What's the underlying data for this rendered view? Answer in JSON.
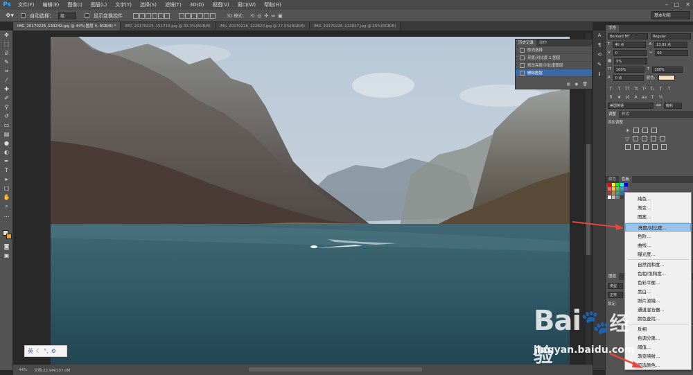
{
  "app": {
    "logo": "Ps"
  },
  "menubar": {
    "items": [
      "文件(F)",
      "编辑(E)",
      "图像(I)",
      "图层(L)",
      "文字(Y)",
      "选择(S)",
      "滤镜(T)",
      "3D(D)",
      "视图(V)",
      "窗口(W)",
      "帮助(H)"
    ],
    "window_controls": [
      "–",
      "□",
      "✕"
    ]
  },
  "options": {
    "auto_select_label": "自动选择：",
    "auto_select_value": "组",
    "show_transform_label": "显示变换控件",
    "mode_3d_label": "3D 模式：",
    "workspace": "基本功能"
  },
  "tabs": [
    {
      "label": "IMG_20170226_133242.jpg @ 44%(图层 4, RGB/8) *",
      "active": true
    },
    {
      "label": "IMG_20170225_151715.jpg @ 33.3%(RGB/8)",
      "active": false
    },
    {
      "label": "IMG_20170226_122820.jpg @ 27.5%(RGB/8)",
      "active": false
    },
    {
      "label": "IMG_20170226_122827.jpg @ 25%(RGB/8)",
      "active": false
    }
  ],
  "history": {
    "tabs": [
      "历史记录",
      "动作"
    ],
    "items": [
      {
        "label": "取消选择",
        "selected": false
      },
      {
        "label": "亮度/对比度 1 图层",
        "selected": false
      },
      {
        "label": "修改亮度/对比度图层",
        "selected": false
      },
      {
        "label": "删除图层",
        "selected": true
      }
    ]
  },
  "status": {
    "zoom": "44%",
    "doc_size": "文档:22.9M/107.0M"
  },
  "ime": {
    "label": "英"
  },
  "character": {
    "tab": "字符",
    "font_family": "Bernard MT ...",
    "font_style": "Regular",
    "size": "40 点",
    "leading": "13.93 点",
    "kerning": "0",
    "tracking": "60",
    "vscale": "100%",
    "hscale": "100%",
    "baseline": "0 点",
    "color_label": "颜色:",
    "tracking_pct": "0%",
    "language": "美国英语",
    "aa": "锐利"
  },
  "adjust": {
    "tabs": [
      "调整",
      "样式"
    ],
    "title": "添加调整"
  },
  "color_panel": {
    "tabs": [
      "颜色",
      "色板"
    ]
  },
  "layers": {
    "tabs": [
      "图层"
    ],
    "kind": "类型",
    "blend": "正常",
    "lock_label": "锁定:"
  },
  "context_menu": {
    "items": [
      "纯色...",
      "渐变...",
      "图案...",
      "亮度/对比度...",
      "色阶...",
      "曲线...",
      "曝光度...",
      "自然饱和度...",
      "色相/饱和度...",
      "色彩平衡...",
      "黑白...",
      "照片滤镜...",
      "通道混合器...",
      "颜色查找...",
      "反相",
      "色调分离...",
      "阈值...",
      "渐变映射...",
      "可选颜色..."
    ],
    "highlighted_index": 3
  },
  "watermark": {
    "brand_a": "Bai",
    "brand_b": "经验",
    "url": "jingyan.baidu.com"
  },
  "colors": {
    "accent_blue": "#3b69a7",
    "menu_highlight": "#9bc3e8",
    "arrow_red": "#e8453c"
  }
}
